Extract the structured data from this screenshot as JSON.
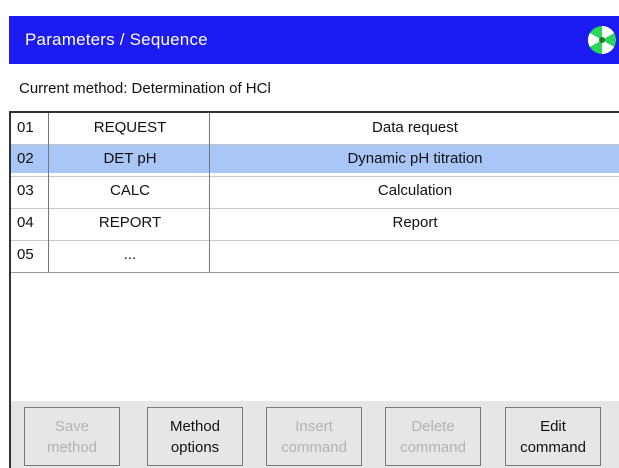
{
  "header": {
    "title": "Parameters / Sequence",
    "logo_icon": "aperture-logo-icon",
    "accent_color": "#1b1bf2"
  },
  "method": {
    "label": "Current method: Determination of HCl"
  },
  "commands": {
    "selected_index": 1,
    "highlight_color": "#a9c6f7",
    "rows": [
      {
        "num": "01",
        "command": "REQUEST",
        "description": "Data request"
      },
      {
        "num": "02",
        "command": "DET pH",
        "description": "Dynamic pH titration"
      },
      {
        "num": "03",
        "command": "CALC",
        "description": "Calculation"
      },
      {
        "num": "04",
        "command": "REPORT",
        "description": "Report"
      },
      {
        "num": "05",
        "command": "...",
        "description": ""
      }
    ]
  },
  "toolbar": {
    "buttons": [
      {
        "label": "Save\nmethod",
        "enabled": false
      },
      {
        "label": "Method\noptions",
        "enabled": true
      },
      {
        "label": "Insert\ncommand",
        "enabled": false
      },
      {
        "label": "Delete\ncommand",
        "enabled": false
      },
      {
        "label": "Edit\ncommand",
        "enabled": true
      }
    ]
  }
}
